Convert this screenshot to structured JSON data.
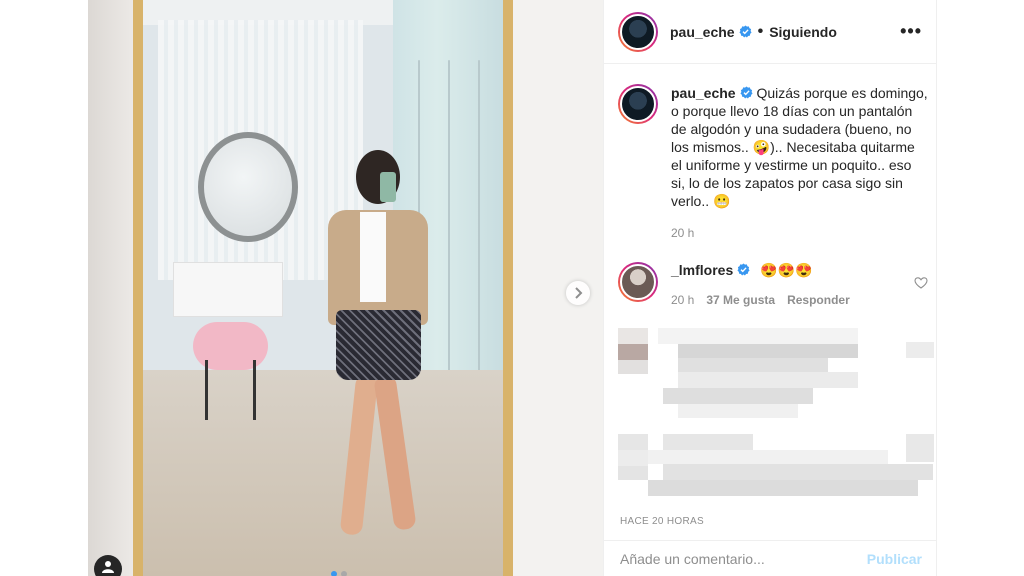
{
  "post": {
    "username": "pau_eche",
    "follow_status": "Siguiendo",
    "separator": "•",
    "more_label": "•••"
  },
  "caption": {
    "username": "pau_eche",
    "text": "Quizás porque es domingo, o porque llevo 18 días con un pantalón de algodón y una sudadera (bueno, no los mismos.. 🤪).. Necesitaba quitarme el uniforme y vestirme un poquito.. eso si, lo de los zapatos por casa sigo sin verlo.. 😬",
    "time": "20 h"
  },
  "comment": {
    "username": "_lmflores",
    "text": "😍😍😍",
    "time": "20 h",
    "likes": "37 Me gusta",
    "reply": "Responder"
  },
  "footer": {
    "timestamp": "HACE 20 HORAS",
    "comment_placeholder": "Añade un comentario...",
    "publish_label": "Publicar"
  },
  "colors": {
    "verified": "#3897f0",
    "link_disabled": "#b2dffc",
    "secondary_text": "#8e8e8e",
    "mirror_frame": "#d8b36a"
  },
  "icons": {
    "verified": "verified-badge-icon",
    "next": "chevron-right-icon",
    "heart": "heart-outline-icon",
    "user_tag": "user-tag-icon"
  },
  "carousel": {
    "current_slide": 1
  }
}
